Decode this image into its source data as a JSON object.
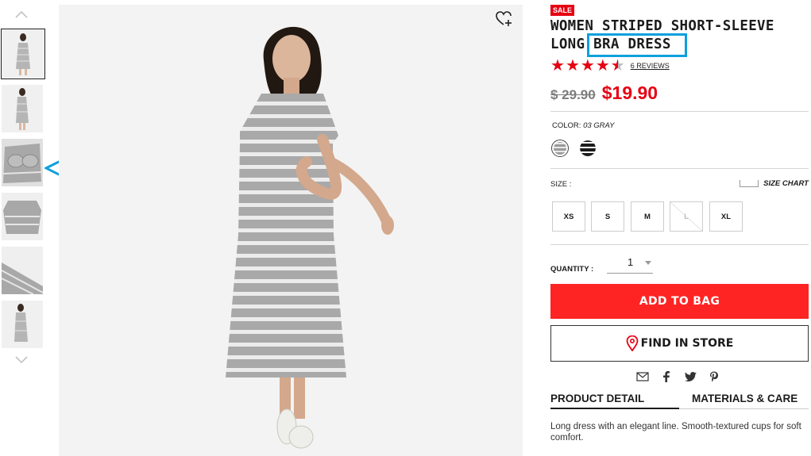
{
  "product": {
    "sale_badge": "SALE",
    "title_line1": "WOMEN STRIPED SHORT-SLEEVE",
    "title_line2": "LONG BRA DRESS",
    "rating": 4.5,
    "reviews": "6 REVIEWS",
    "old_price": "$ 29.90",
    "new_price": "$19.90",
    "description": "Long dress with an elegant line. Smooth-textured cups for soft comfort."
  },
  "color": {
    "label": "COLOR:",
    "value": "03 GRAY",
    "swatches": [
      {
        "name": "gray-stripe",
        "color": "#9a9a9a",
        "selected": true
      },
      {
        "name": "black-stripe",
        "color": "#1b1b1b",
        "selected": false
      }
    ]
  },
  "size": {
    "label": "SIZE :",
    "chart_label": "SIZE CHART",
    "options": [
      {
        "label": "XS",
        "available": true
      },
      {
        "label": "S",
        "available": true
      },
      {
        "label": "M",
        "available": true
      },
      {
        "label": "L",
        "available": false
      },
      {
        "label": "XL",
        "available": true
      }
    ]
  },
  "quantity": {
    "label": "QUANTITY :",
    "value": "1"
  },
  "actions": {
    "add_to_bag": "ADD TO BAG",
    "find_in_store": "FIND IN STORE"
  },
  "tabs": {
    "product_detail": "PRODUCT DETAIL",
    "materials": "MATERIALS & CARE"
  },
  "colors": {
    "accent_red": "#e60012",
    "button_red": "#ff2424",
    "highlight_blue": "#0ea0de"
  }
}
